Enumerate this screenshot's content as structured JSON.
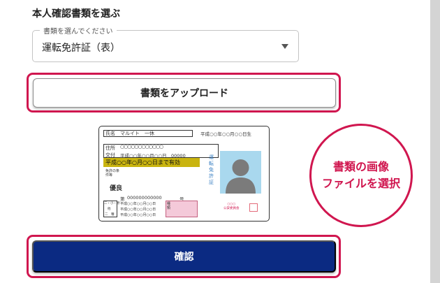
{
  "section": {
    "title": "本人確認書類を選ぶ"
  },
  "document_select": {
    "legend": "書類を選んでください",
    "value": "運転免許証（表）"
  },
  "upload_button": {
    "label": "書類をアップロード"
  },
  "confirm_button": {
    "label": "確認"
  },
  "callout": {
    "line1": "書類の画像",
    "line2": "ファイルを選択"
  },
  "license": {
    "name_label": "氏名",
    "name_value": "マルイト　一休",
    "birth": "平成○○年○○月○○日生",
    "address_label": "住所",
    "address_value": "○○○○○○○○○○○○",
    "issue_label": "交付",
    "issue_value": "平成○○年○○月○○日　00000",
    "expiry": "平成○○年○月○○日まで有効",
    "conditions": "免許の条件等",
    "excellent": "優良",
    "number_label": "第",
    "number_value": "000000000000",
    "number_suffix": "号",
    "category_label": "種類",
    "vertical_title": "運転免許証",
    "authority": "○○○\n公安委員会",
    "rows": [
      {
        "label": "二・小・原",
        "date": "平成○○年○○月○○日"
      },
      {
        "label": "他",
        "date": "平成○○年○○月○○日"
      },
      {
        "label": "二　種",
        "date": "平成○○年○○月○○日"
      }
    ]
  },
  "colors": {
    "accent_pink": "#d0164f",
    "primary_navy": "#0b2a82",
    "license_band": "#c9b410",
    "photo_blue": "#a9d8ee"
  }
}
